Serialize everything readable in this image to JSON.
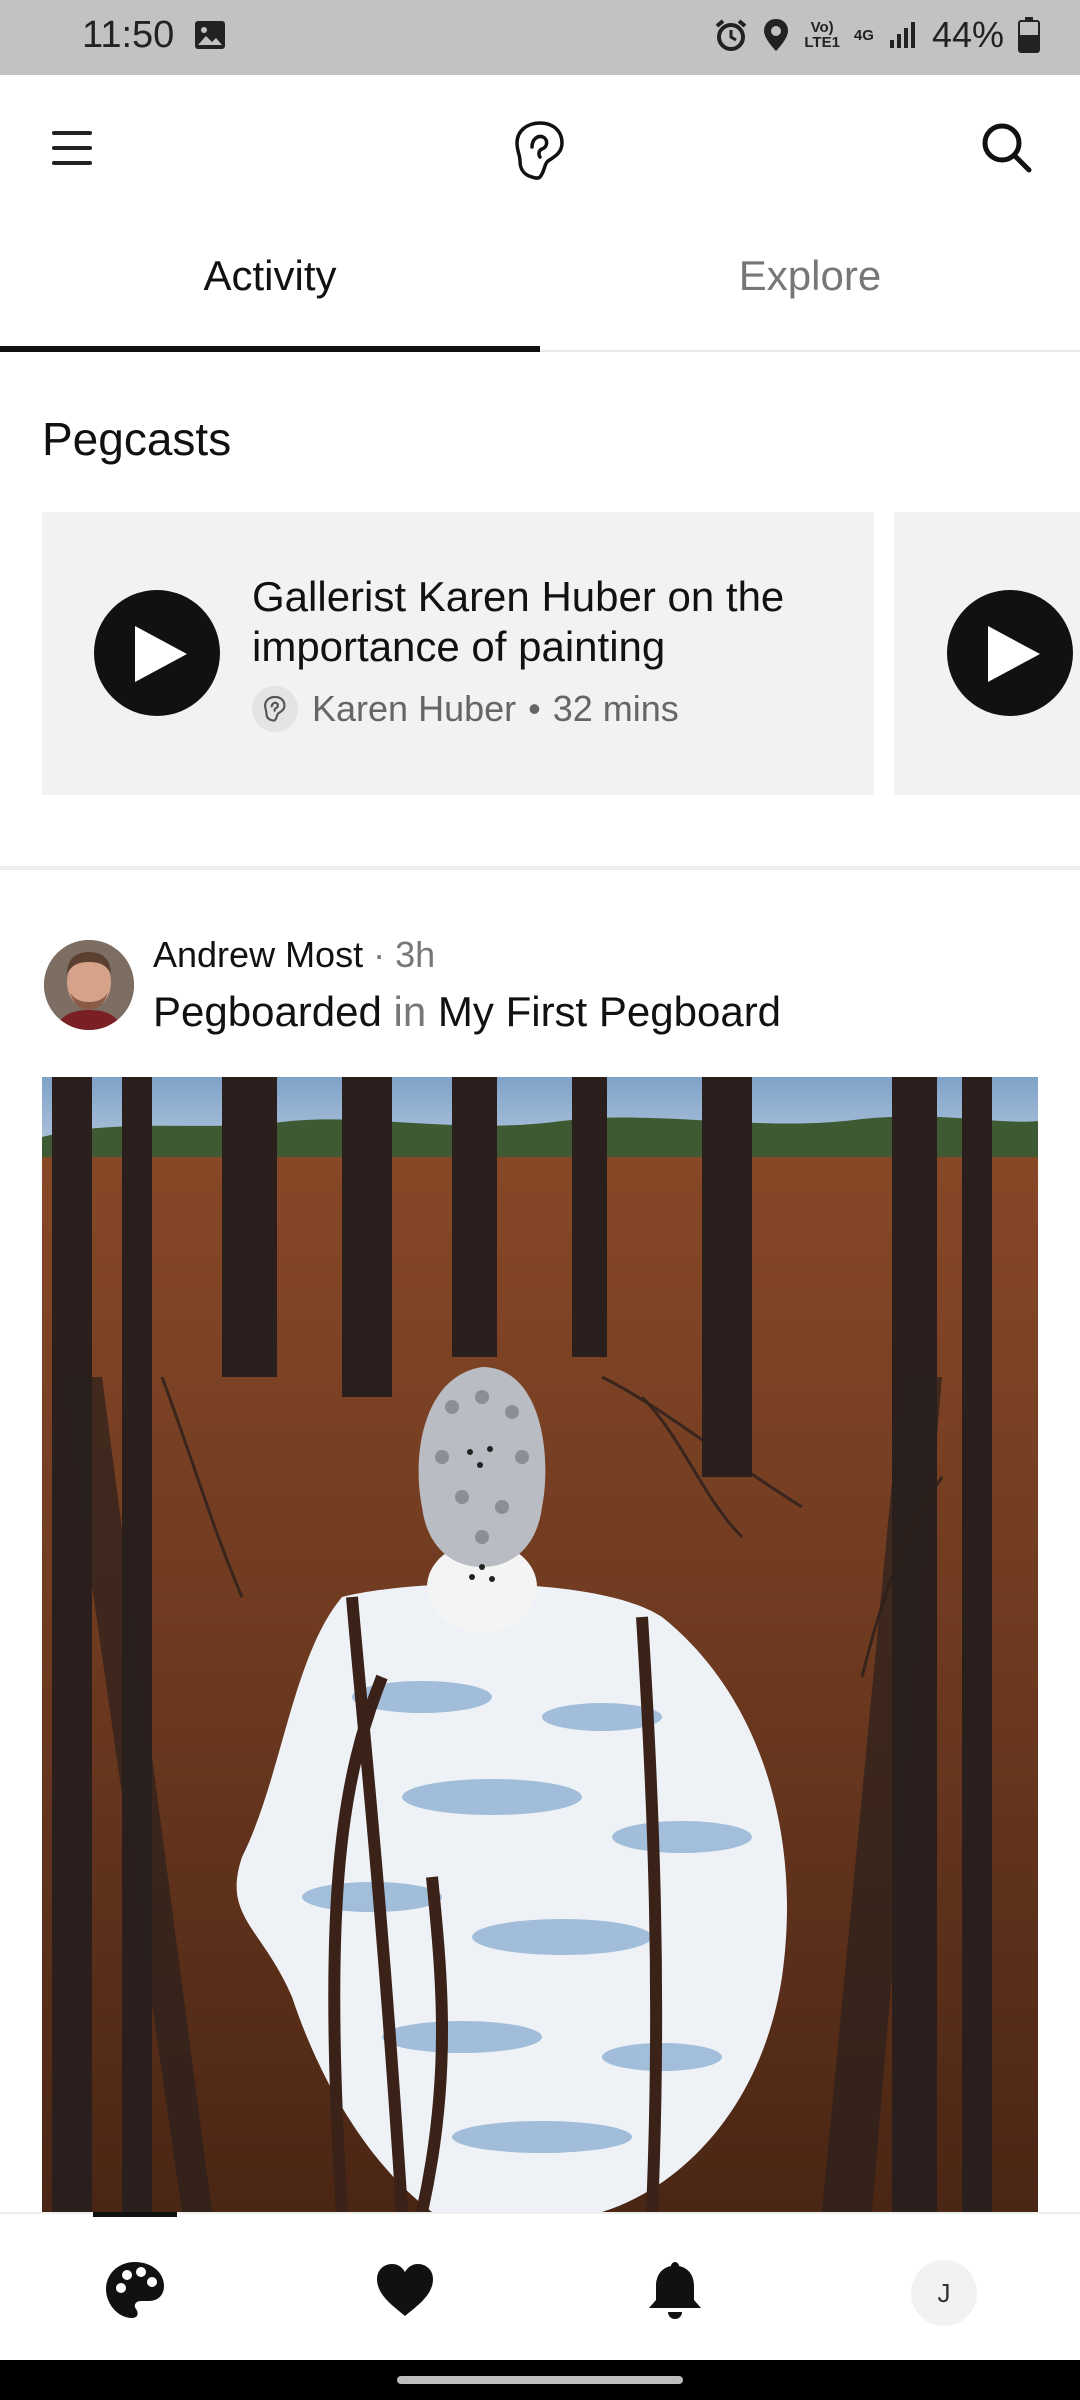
{
  "status_bar": {
    "time": "11:50",
    "network_top": "Vo)",
    "network_bottom": "LTE1",
    "network_type": "4G",
    "battery": "44%"
  },
  "header": {
    "menu_icon": "hamburger-icon",
    "logo_icon": "ear-logo-icon",
    "search_icon": "search-icon"
  },
  "tabs": [
    {
      "label": "Activity",
      "active": true
    },
    {
      "label": "Explore",
      "active": false
    }
  ],
  "pegcasts": {
    "title": "Pegcasts",
    "items": [
      {
        "title": "Gallerist Karen Huber on the importance of painting",
        "author": "Karen Huber",
        "duration": "32 mins"
      }
    ]
  },
  "post": {
    "user": "Andrew Most",
    "time": "· 3h",
    "action": "Pegboarded",
    "in_word": "in",
    "board": "My First Pegboard"
  },
  "bottom_nav": {
    "items": [
      "palette-icon",
      "heart-icon",
      "bell-icon",
      "profile-avatar"
    ],
    "profile_initial": "J"
  },
  "colors": {
    "accent": "#111111",
    "muted": "#777777",
    "card_bg": "#f2f2f2"
  }
}
